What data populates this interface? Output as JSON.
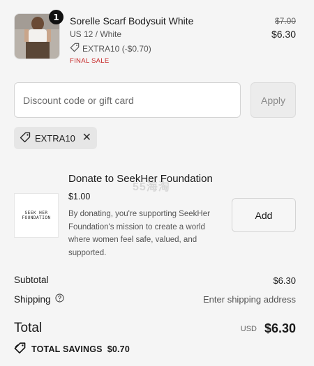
{
  "product": {
    "quantity": "1",
    "name": "Sorelle Scarf Bodysuit White",
    "variant": "US 12 / White",
    "discount_applied": "EXTRA10 (-$0.70)",
    "final_sale": "FINAL SALE",
    "price_original": "$7.00",
    "price_current": "$6.30"
  },
  "discount": {
    "placeholder": "Discount code or gift card",
    "apply_label": "Apply",
    "applied_code": "EXTRA10"
  },
  "donation": {
    "title": "Donate to SeekHer Foundation",
    "amount": "$1.00",
    "description": "By donating, you're supporting SeekHer Foundation's mission to create a world where women feel safe, valued, and supported.",
    "add_label": "Add",
    "logo_line1": "SEEK HER",
    "logo_line2": "FOUNDATION"
  },
  "summary": {
    "subtotal_label": "Subtotal",
    "subtotal_value": "$6.30",
    "shipping_label": "Shipping",
    "shipping_value": "Enter shipping address",
    "total_label": "Total",
    "currency": "USD",
    "total_value": "$6.30",
    "savings_label": "TOTAL SAVINGS",
    "savings_value": "$0.70"
  },
  "watermark": "55海淘"
}
